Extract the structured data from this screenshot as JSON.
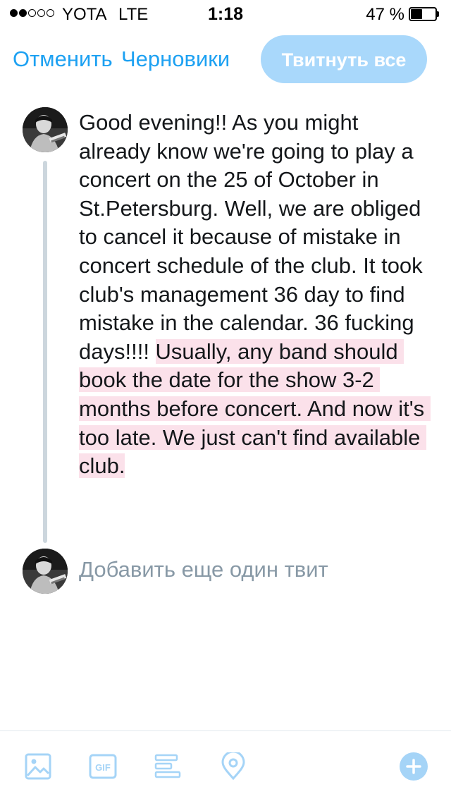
{
  "status_bar": {
    "carrier": "YOTA",
    "network": "LTE",
    "time": "1:18",
    "battery_percent": "47 %",
    "battery_level": 0.47,
    "signal_strength": 2
  },
  "header": {
    "cancel_label": "Отменить",
    "drafts_label": "Черновики",
    "tweet_all_label": "Твитнуть все"
  },
  "tweet": {
    "text_within_limit": "Good evening!! As you might already know we're going to play a concert on the 25 of October in St.Petersburg. Well, we are obliged to cancel it because of mistake in concert schedule of the club. It took club's management 36 day to find mistake in the calendar. 36 fucking days!!!! ",
    "text_over_limit": "Usually, any band should book the date for the show 3-2 months before concert. And now it's too late. We just can't find available club."
  },
  "add_tweet_placeholder": "Добавить еще один твит",
  "toolbar": {
    "icons": [
      "image-icon",
      "gif-icon",
      "poll-icon",
      "location-icon",
      "add-tweet-icon"
    ]
  },
  "colors": {
    "accent": "#1da1f2",
    "button_disabled": "#a9d8fb",
    "overflow_highlight": "#fbe1ea",
    "icon": "#a5d4f7",
    "placeholder": "#8899a6"
  }
}
